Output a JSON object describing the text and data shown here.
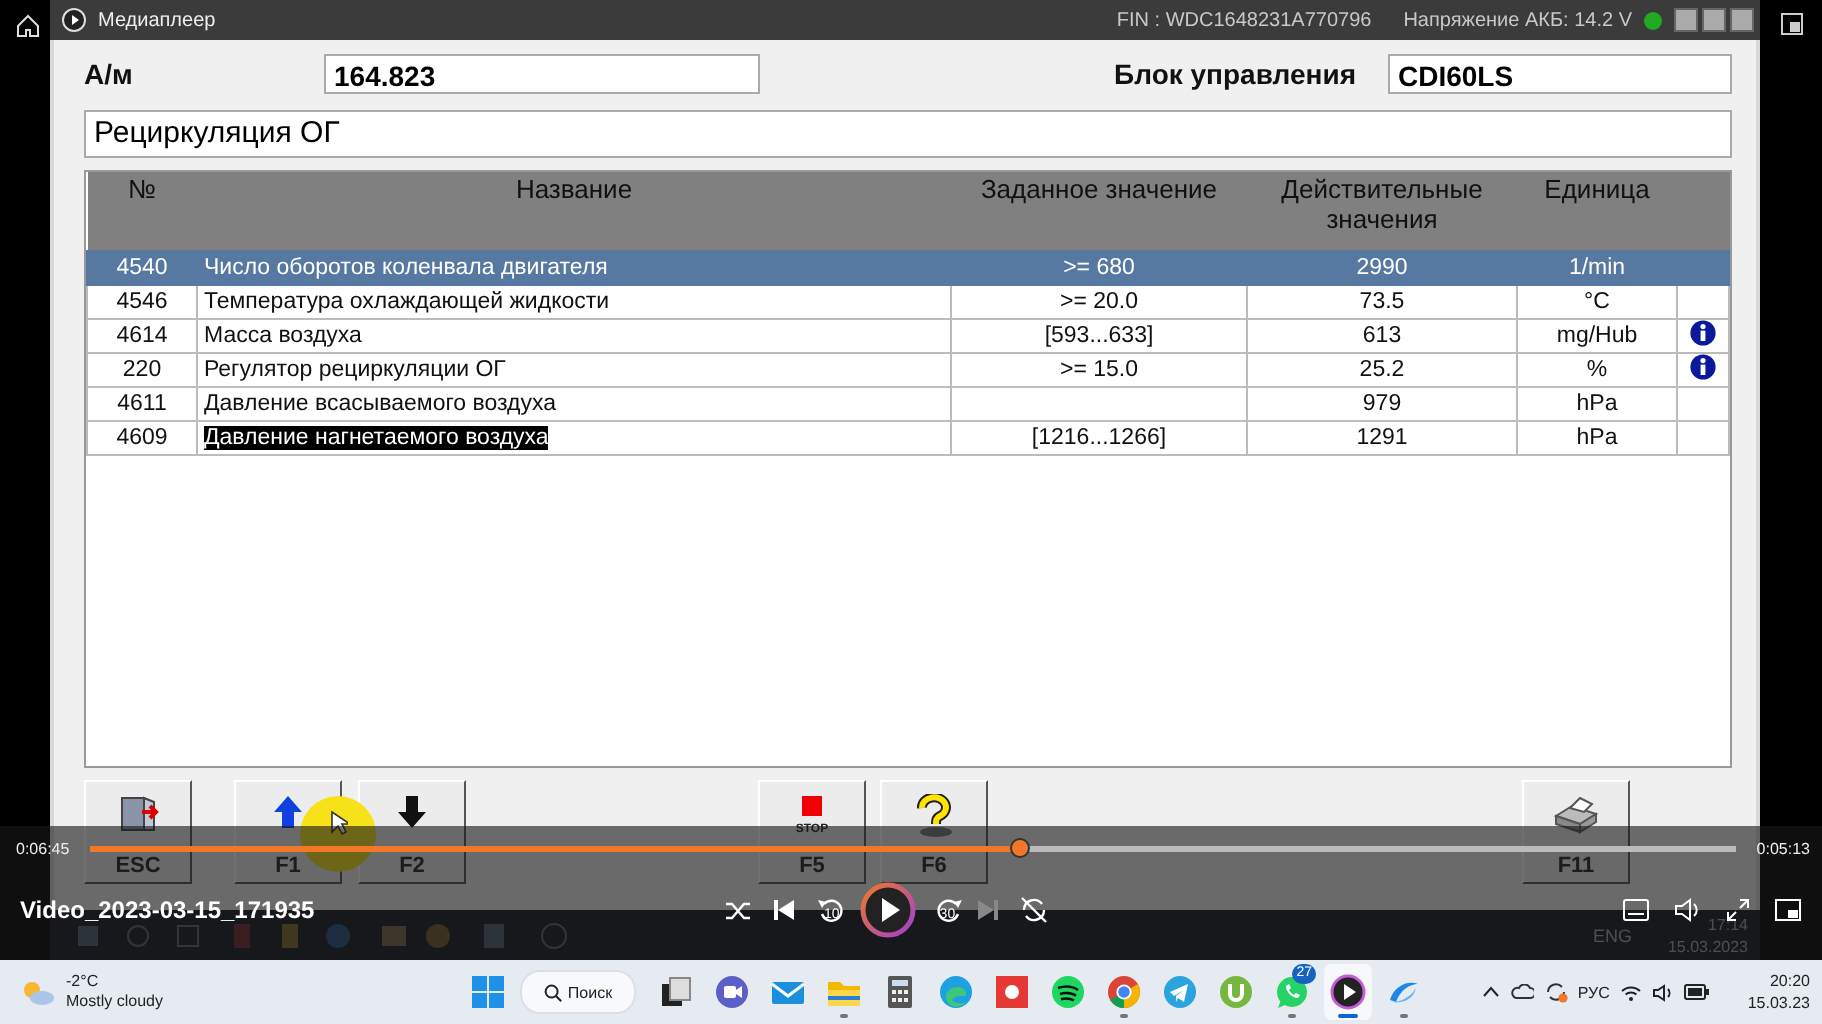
{
  "player": {
    "title": "Медиаплеер",
    "video_title": "Video_2023-03-15_171935",
    "elapsed": "0:06:45",
    "remaining": "0:05:13",
    "level": 0.565,
    "paused": true,
    "skip_back": "10",
    "skip_forward": "30"
  },
  "diagnostic": {
    "fin": "FIN : WDC1648231A770796",
    "battery": "Напряжение АКБ: 14.2 V",
    "vehicle_label": "А/м",
    "vehicle_value": "164.823",
    "unit_label": "Блок управления",
    "unit_value": "CDI60LS",
    "function": "Рециркуляция ОГ",
    "table": {
      "columns": [
        "№",
        "Название",
        "Заданное значение",
        "Действительные значения",
        "Единица"
      ],
      "rows": [
        {
          "number": "4540",
          "name": "Число оборотов коленвала двигателя",
          "setpoint": ">= 680",
          "actual": "2990",
          "unit": "1/min",
          "info": false,
          "selected": true,
          "highlighted": false
        },
        {
          "number": "4546",
          "name": "Температура охлаждающей жидкости",
          "setpoint": ">= 20.0",
          "actual": "73.5",
          "unit": "°C",
          "info": false,
          "selected": false,
          "highlighted": false
        },
        {
          "number": "4614",
          "name": "Масса воздуха",
          "setpoint": "[593...633]",
          "actual": "613",
          "unit": "mg/Hub",
          "info": true,
          "selected": false,
          "highlighted": false
        },
        {
          "number": "220",
          "name": "Регулятор рециркуляции ОГ",
          "setpoint": ">= 15.0",
          "actual": "25.2",
          "unit": "%",
          "info": true,
          "selected": false,
          "highlighted": false
        },
        {
          "number": "4611",
          "name": "Давление всасываемого воздуха",
          "actual": "979",
          "unit": "hPa",
          "info": false,
          "selected": false,
          "highlighted": false
        },
        {
          "number": "4609",
          "name": "Давление нагнетаемого воздуха",
          "setpoint": "[1216...1266]",
          "actual": "1291",
          "unit": "hPa",
          "info": false,
          "selected": false,
          "highlighted": true
        }
      ]
    },
    "keys": [
      {
        "label": "ESC",
        "kind": "exit"
      },
      {
        "label": "F1",
        "kind": "up"
      },
      {
        "label": "F2",
        "kind": "down"
      },
      {
        "label": "F5",
        "kind": "stop",
        "caption": "STOP"
      },
      {
        "label": "F6",
        "kind": "help"
      },
      {
        "label": "F11",
        "kind": "print"
      }
    ],
    "video_taskbar": {
      "language": "ENG",
      "time": "17:14",
      "date": "15.03.2023"
    }
  },
  "taskbar": {
    "weather_temp": "-2°C",
    "weather_text": "Mostly cloudy",
    "search": "Поиск",
    "apps": [
      {
        "kind": "taskview",
        "running": false,
        "selected": false
      },
      {
        "kind": "chat",
        "running": false,
        "selected": false
      },
      {
        "kind": "mail",
        "running": false,
        "selected": false
      },
      {
        "kind": "folder",
        "running": true,
        "selected": false
      },
      {
        "kind": "calculator",
        "running": false,
        "selected": false
      },
      {
        "kind": "edge",
        "running": false,
        "selected": false
      },
      {
        "kind": "record",
        "running": false,
        "selected": false
      },
      {
        "kind": "music",
        "running": false,
        "selected": false
      },
      {
        "kind": "chrome",
        "running": true,
        "selected": false
      },
      {
        "kind": "telegram",
        "running": false,
        "selected": false
      },
      {
        "kind": "torrent",
        "running": false,
        "selected": false
      },
      {
        "kind": "whatsapp",
        "running": true,
        "selected": false,
        "badge": "27"
      },
      {
        "kind": "player",
        "running": true,
        "selected": true
      },
      {
        "kind": "swoosh",
        "running": true,
        "selected": false
      }
    ],
    "language": "РУС",
    "time": "20:20",
    "date": "15.03.23"
  }
}
